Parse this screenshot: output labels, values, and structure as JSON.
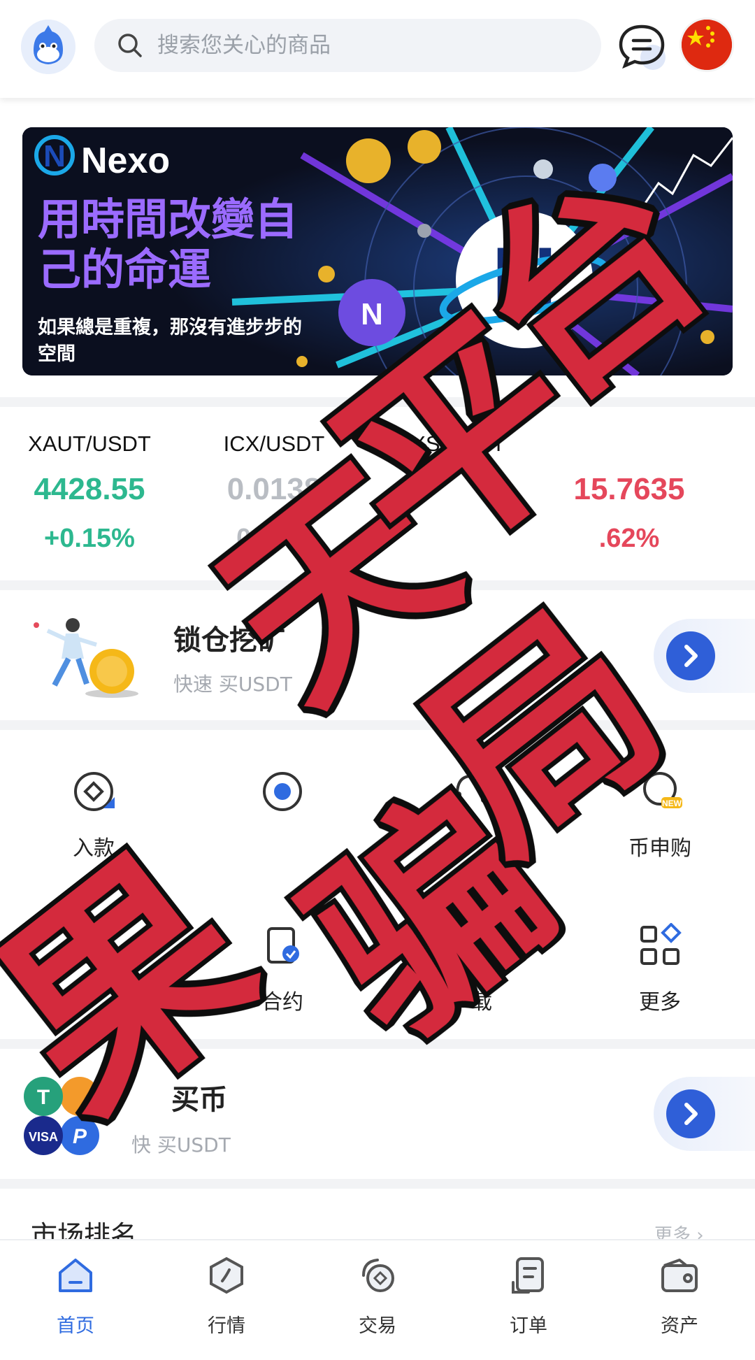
{
  "header": {
    "search_placeholder": "搜索您关心的商品"
  },
  "banner": {
    "brand": "Nexo",
    "headline": "用時間改變自己的命運",
    "subtext": "如果總是重複，那沒有進步步的空間"
  },
  "tickers": [
    {
      "pair": "XAUT/USDT",
      "price": "4428.55",
      "change": "+0.15%",
      "trend": "up"
    },
    {
      "pair": "ICX/USDT",
      "price": "0.0138",
      "change": "0.00%",
      "trend": "flat"
    },
    {
      "pair": "AXS/USDT",
      "price": "",
      "change": "",
      "trend": "up"
    },
    {
      "pair": "",
      "price": "15.7635",
      "change": ".62%",
      "trend": "down"
    }
  ],
  "promo_mining": {
    "title": "锁仓挖矿",
    "subtitle": "快速 买USDT"
  },
  "grid": [
    {
      "label": "入款",
      "icon": "deposit-icon"
    },
    {
      "label": "",
      "icon": "withdraw-icon"
    },
    {
      "label": "",
      "icon": "customer-service-icon"
    },
    {
      "label": "币申购",
      "icon": "new-coin-subscription-icon"
    },
    {
      "label": "",
      "icon": "options-icon"
    },
    {
      "label": "合约",
      "icon": "contract-icon"
    },
    {
      "label": "下载",
      "icon": "download-app-icon"
    },
    {
      "label": "更多",
      "icon": "more-grid-icon"
    }
  ],
  "promo_buy": {
    "title": "买币",
    "subtitle": "快 买USDT"
  },
  "market": {
    "title": "市场排名",
    "more": "更多"
  },
  "tabs": [
    {
      "label": "首页",
      "active": true
    },
    {
      "label": "行情",
      "active": false
    },
    {
      "label": "交易",
      "active": false
    },
    {
      "label": "订单",
      "active": false
    },
    {
      "label": "资产",
      "active": false
    }
  ],
  "overlay_text": "果天平台骗局",
  "colors": {
    "up": "#2db88f",
    "down": "#e5475b",
    "flat": "#b9bdc3",
    "accent": "#2f6be0",
    "overlay": "#d42a3c"
  }
}
